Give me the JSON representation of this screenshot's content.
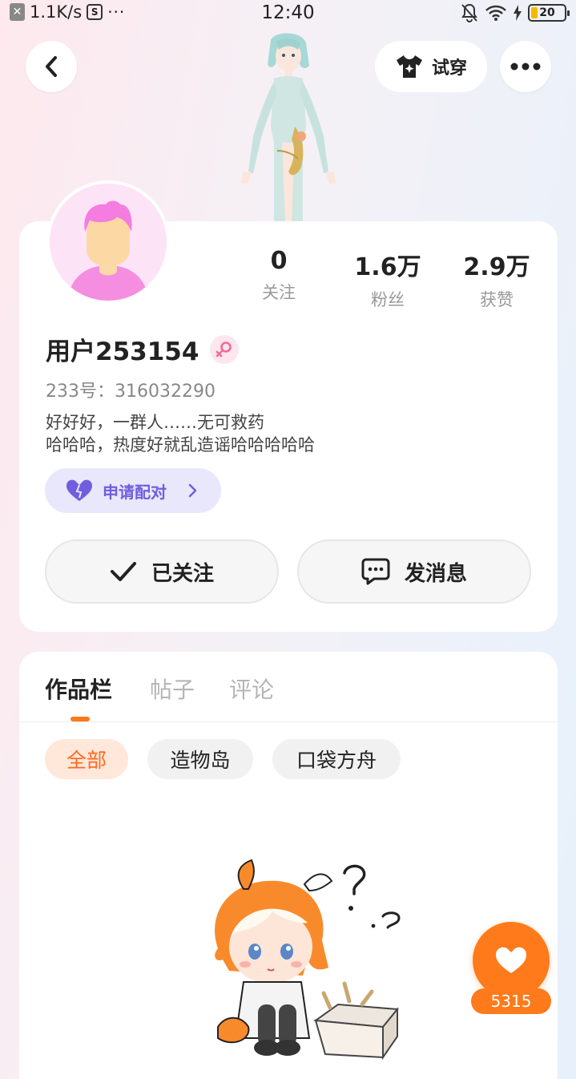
{
  "status_bar": {
    "speed": "1.1K/s",
    "dots": "···",
    "time": "12:40",
    "battery": "20"
  },
  "header": {
    "back_icon": "chevron-left-icon",
    "try_on_label": "试穿",
    "try_on_icon": "shirt-sparkle-icon",
    "more_icon": "ellipsis-icon"
  },
  "profile": {
    "stats": [
      {
        "value": "0",
        "label": "关注"
      },
      {
        "value": "1.6万",
        "label": "粉丝"
      },
      {
        "value": "2.9万",
        "label": "获赞"
      }
    ],
    "username": "用户253154",
    "gender_icon": "female-icon",
    "id_line": "233号：316032290",
    "bio_lines": [
      "好好好，一群人……无可救药",
      "哈哈哈，热度好就乱造谣哈哈哈哈哈"
    ],
    "pair_button": "申请配对",
    "follow_button": "已关注",
    "message_button": "发消息"
  },
  "works": {
    "tabs": [
      "作品栏",
      "帖子",
      "评论"
    ],
    "active_tab": 0,
    "filters": [
      "全部",
      "造物岛",
      "口袋方舟"
    ],
    "active_filter": 0
  },
  "like": {
    "count": "5315",
    "icon": "heart-icon"
  },
  "colors": {
    "accent": "#ff7a1a",
    "pair_purple": "#6f5ee0",
    "gender_pink": "#f36a9a"
  }
}
